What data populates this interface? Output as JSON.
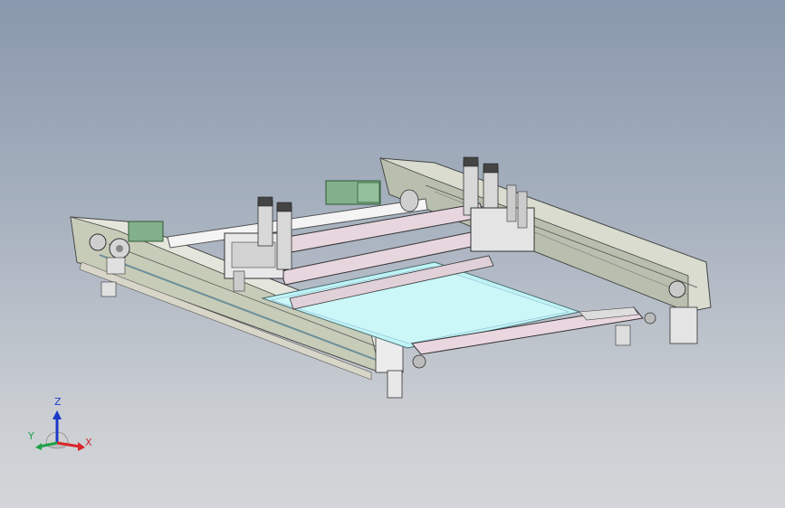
{
  "viewport": {
    "background_top": "#8a98ad",
    "background_bottom": "#d3d5d8"
  },
  "model": {
    "frame_color": "#e7e2de",
    "rail_color": "#c8ccc0",
    "print_bed_color": "#bff4f6",
    "motor_color": "#82b08a",
    "shaft_color": "#f2f2f2"
  },
  "triad": {
    "x_label": "X",
    "y_label": "Y",
    "z_label": "Z",
    "x_color": "#d8262b",
    "y_color": "#1fa24a",
    "z_color": "#1b38c8"
  }
}
